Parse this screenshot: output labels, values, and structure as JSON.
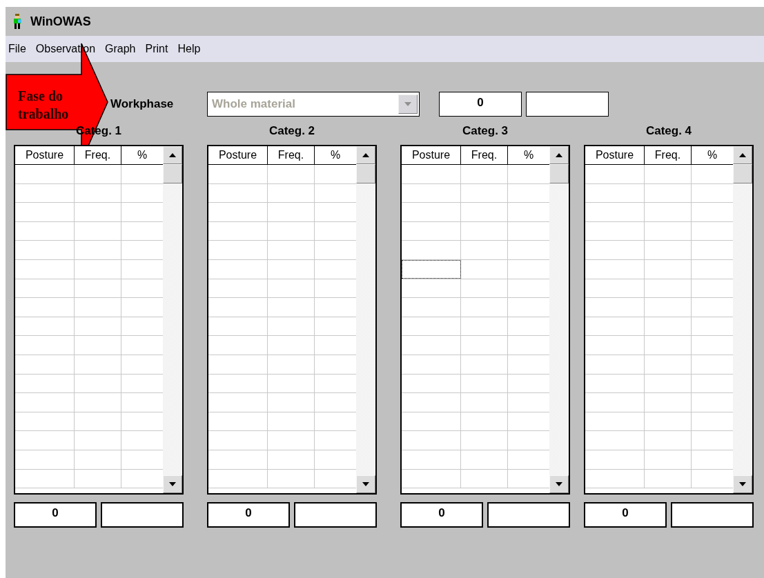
{
  "window": {
    "title": "WinOWAS"
  },
  "menu": [
    "File",
    "Observation",
    "Graph",
    "Print",
    "Help"
  ],
  "annotation": {
    "text": "Fase do trabalho"
  },
  "workphase": {
    "label": "Workphase",
    "value": "Whole material",
    "disabled": true,
    "count": "0"
  },
  "panels": [
    {
      "title": "Categ. 1",
      "columns": [
        "Posture",
        "Freq.",
        "%"
      ],
      "total": "0",
      "rows": [
        {
          "focused": false
        },
        {
          "focused": false
        },
        {
          "focused": false
        },
        {
          "focused": false
        },
        {
          "focused": false
        },
        {
          "focused": false
        },
        {
          "focused": false
        },
        {
          "focused": false
        },
        {
          "focused": false
        },
        {
          "focused": false
        },
        {
          "focused": false
        },
        {
          "focused": false
        },
        {
          "focused": false
        },
        {
          "focused": false
        },
        {
          "focused": false
        },
        {
          "focused": false
        },
        {
          "focused": false
        }
      ]
    },
    {
      "title": "Categ. 2",
      "columns": [
        "Posture",
        "Freq.",
        "%"
      ],
      "total": "0",
      "rows": [
        {
          "focused": false
        },
        {
          "focused": false
        },
        {
          "focused": false
        },
        {
          "focused": false
        },
        {
          "focused": false
        },
        {
          "focused": false
        },
        {
          "focused": false
        },
        {
          "focused": false
        },
        {
          "focused": false
        },
        {
          "focused": false
        },
        {
          "focused": false
        },
        {
          "focused": false
        },
        {
          "focused": false
        },
        {
          "focused": false
        },
        {
          "focused": false
        },
        {
          "focused": false
        },
        {
          "focused": false
        }
      ]
    },
    {
      "title": "Categ. 3",
      "columns": [
        "Posture",
        "Freq.",
        "%"
      ],
      "total": "0",
      "rows": [
        {
          "focused": false
        },
        {
          "focused": false
        },
        {
          "focused": false
        },
        {
          "focused": false
        },
        {
          "focused": false
        },
        {
          "focused": true
        },
        {
          "focused": false
        },
        {
          "focused": false
        },
        {
          "focused": false
        },
        {
          "focused": false
        },
        {
          "focused": false
        },
        {
          "focused": false
        },
        {
          "focused": false
        },
        {
          "focused": false
        },
        {
          "focused": false
        },
        {
          "focused": false
        },
        {
          "focused": false
        }
      ]
    },
    {
      "title": "Categ. 4",
      "columns": [
        "Posture",
        "Freq.",
        "%"
      ],
      "total": "0",
      "rows": [
        {
          "focused": false
        },
        {
          "focused": false
        },
        {
          "focused": false
        },
        {
          "focused": false
        },
        {
          "focused": false
        },
        {
          "focused": false
        },
        {
          "focused": false
        },
        {
          "focused": false
        },
        {
          "focused": false
        },
        {
          "focused": false
        },
        {
          "focused": false
        },
        {
          "focused": false
        },
        {
          "focused": false
        },
        {
          "focused": false
        },
        {
          "focused": false
        },
        {
          "focused": false
        },
        {
          "focused": false
        }
      ]
    }
  ]
}
